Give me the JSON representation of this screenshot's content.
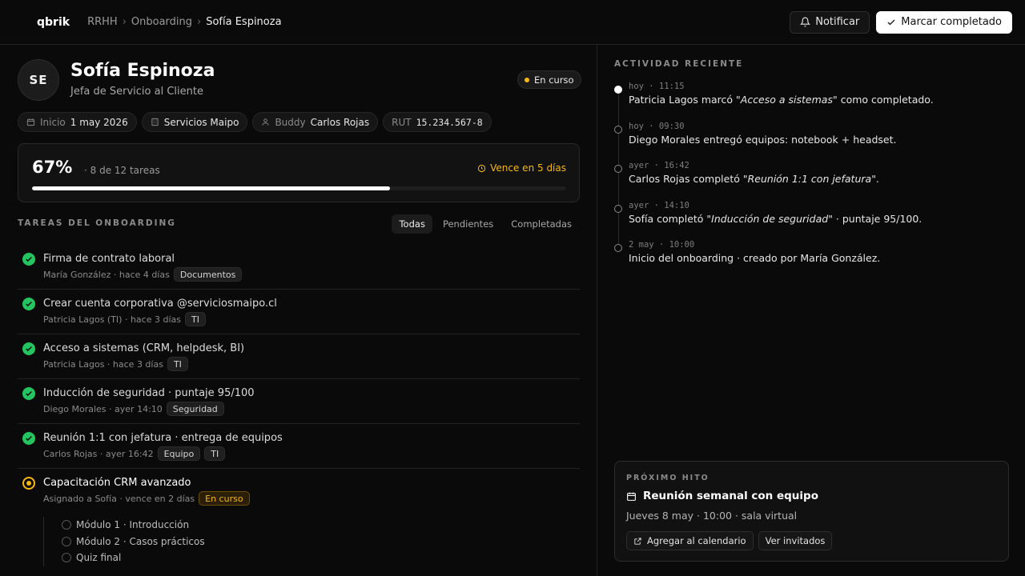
{
  "app": {
    "logo": "qbrik"
  },
  "breadcrumb": [
    "RRHH",
    "Onboarding",
    "Sofía Espinoza"
  ],
  "top_actions": {
    "notify": "Notificar",
    "complete": "Marcar completado"
  },
  "profile": {
    "initials": "SE",
    "name": "Sofía Espinoza",
    "role": "Jefa de Servicio al Cliente",
    "status": "En curso",
    "chips": [
      {
        "key": "Inicio",
        "value": "1 may 2026",
        "icon": "calendar-icon"
      },
      {
        "key": "",
        "value": "Servicios Maipo",
        "icon": "building-icon"
      },
      {
        "key": "Buddy",
        "value": "Carlos Rojas",
        "icon": "user-icon"
      },
      {
        "key": "RUT",
        "value": "15.234.567-8",
        "icon": ""
      }
    ]
  },
  "progress": {
    "percent": "67%",
    "fraction": 0.67,
    "detail": "· 8 de 12 tareas",
    "due": "Vence en 5 días"
  },
  "tasks_section": {
    "title": "TAREAS DEL ONBOARDING",
    "filters": [
      "Todas",
      "Pendientes",
      "Completadas"
    ],
    "active_filter": "Todas",
    "tasks": [
      {
        "title": "Firma de contrato laboral",
        "meta": "María González · hace 4 días",
        "tags": [
          "Documentos"
        ],
        "state": "done"
      },
      {
        "title": "Crear cuenta corporativa @serviciosmaipo.cl",
        "meta": "Patricia Lagos (TI) · hace 3 días",
        "tags": [
          "TI"
        ],
        "state": "done"
      },
      {
        "title": "Acceso a sistemas (CRM, helpdesk, BI)",
        "meta": "Patricia Lagos · hace 3 días",
        "tags": [
          "TI"
        ],
        "state": "done"
      },
      {
        "title": "Inducción de seguridad · puntaje 95/100",
        "meta": "Diego Morales · ayer 14:10",
        "tags": [
          "Seguridad"
        ],
        "state": "done"
      },
      {
        "title": "Reunión 1:1 con jefatura · entrega de equipos",
        "meta": "Carlos Rojas · ayer 16:42",
        "tags": [
          "Equipo",
          "TI"
        ],
        "state": "done"
      },
      {
        "title": "Capacitación CRM avanzado",
        "meta": "Asignado a Sofía · vence en 2 días",
        "tags": [
          "En curso"
        ],
        "state": "current"
      }
    ],
    "subtasks": [
      "Módulo 1 · Introducción",
      "Módulo 2 · Casos prácticos",
      "Quiz final"
    ]
  },
  "activity": {
    "title": "ACTIVIDAD RECIENTE",
    "events": [
      {
        "when": "hoy · 11:15",
        "pre": "Patricia Lagos marcó \"",
        "em": "Acceso a sistemas",
        "post": "\" como completado."
      },
      {
        "when": "hoy · 09:30",
        "pre": "Diego Morales entregó equipos: notebook + headset.",
        "em": "",
        "post": ""
      },
      {
        "when": "ayer · 16:42",
        "pre": "Carlos Rojas completó \"",
        "em": "Reunión 1:1 con jefatura",
        "post": "\"."
      },
      {
        "when": "ayer · 14:10",
        "pre": "Sofía completó \"",
        "em": "Inducción de seguridad",
        "post": "\" · puntaje 95/100."
      },
      {
        "when": "2 may · 10:00",
        "pre": "Inicio del onboarding · creado por María González.",
        "em": "",
        "post": ""
      }
    ]
  },
  "milestone": {
    "label": "PRÓXIMO HITO",
    "title": "Reunión semanal con equipo",
    "when": "Jueves 8 may · 10:00 · sala virtual",
    "actions": [
      "Agregar al calendario",
      "Ver invitados"
    ]
  },
  "colors": {
    "accent": "#f5b80f",
    "success": "#22c55e",
    "background": "#0a0a0a"
  }
}
